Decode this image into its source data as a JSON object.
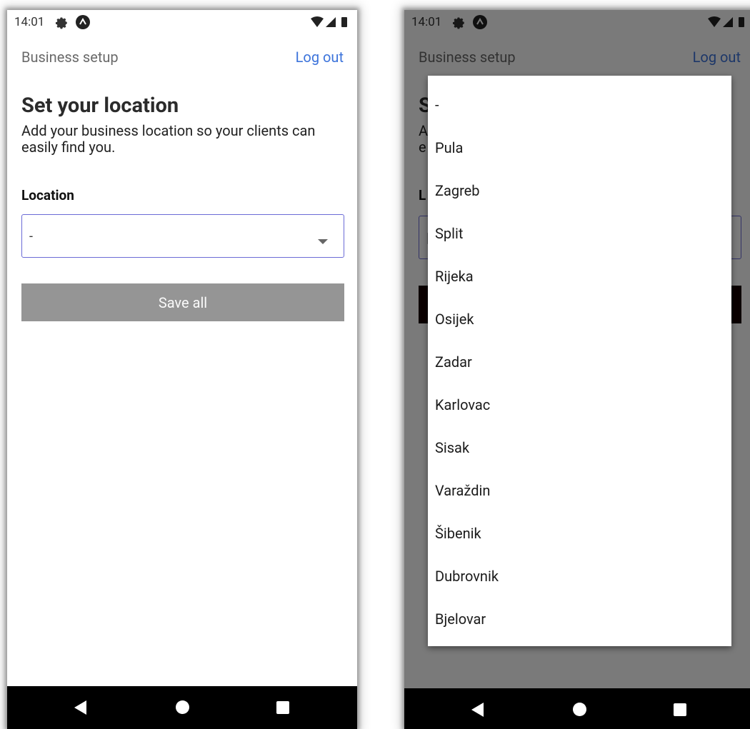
{
  "status": {
    "time": "14:01"
  },
  "header": {
    "title": "Business setup",
    "logout": "Log out"
  },
  "content": {
    "title": "Set your location",
    "subtitle": "Add your business location so your clients can easily find you.",
    "location_label": "Location",
    "location_value": "-",
    "save_label": "Save all"
  },
  "right_partial": {
    "title_fragment": "S",
    "subtitle_line1_fragment": "A",
    "subtitle_line2_fragment": "e",
    "label_fragment": "L",
    "select_fragment": "|"
  },
  "dropdown": {
    "options": [
      "-",
      "Pula",
      "Zagreb",
      "Split",
      "Rijeka",
      "Osijek",
      "Zadar",
      "Karlovac",
      "Sisak",
      "Varaždin",
      "Šibenik",
      "Dubrovnik",
      "Bjelovar"
    ]
  },
  "icons": {
    "settings": "gear-icon",
    "app": "app-notification-icon",
    "wifi": "wifi-icon",
    "cell": "cell-signal-icon",
    "battery": "battery-icon",
    "caret": "dropdown-caret-icon",
    "back": "back-icon",
    "home": "home-icon",
    "recent": "recent-apps-icon"
  },
  "colors": {
    "accent": "#3d74db",
    "select_border": "#6b6bd6",
    "save_button": "#959595",
    "navbar": "#000000"
  }
}
